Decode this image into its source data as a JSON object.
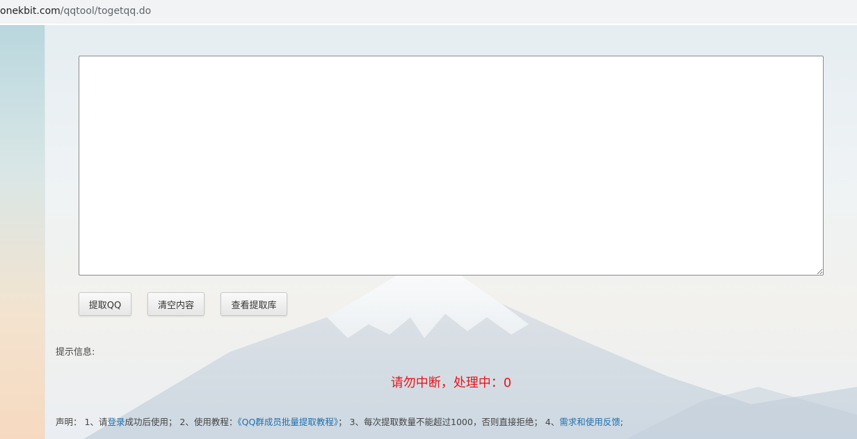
{
  "browser": {
    "url_host": "onekbit.com",
    "url_path": "/qqtool/togetqq.do"
  },
  "form": {
    "textarea_value": "",
    "buttons": {
      "extract": "提取QQ",
      "clear": "清空内容",
      "library": "查看提取库"
    }
  },
  "hint": {
    "label": "提示信息:",
    "status": "请勿中断，处理中：0"
  },
  "statement": {
    "prefix": "声明： 1、请",
    "login_link": "登录",
    "part1": "成功后使用； 2、使用教程：",
    "tutorial_link": "《QQ群成员批量提取教程》",
    "part2": "； 3、每次提取数量不能超过1000，否则直接拒绝； 4、",
    "feedback_link": "需求和使用反馈",
    "suffix": ";"
  },
  "colors": {
    "status_red": "#e8141a",
    "link_blue": "#1f6fae"
  }
}
